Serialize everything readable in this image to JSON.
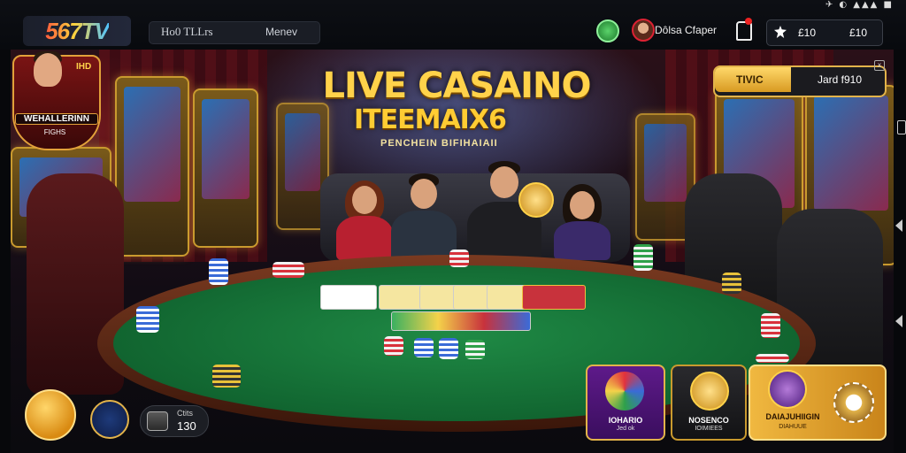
{
  "status_bar": {
    "text": "✈ ◐ ▲▲▲ ■"
  },
  "header": {
    "logo_text": "567TV",
    "nav_label_1": "Ho0 TLLrs",
    "nav_label_2": "Menev",
    "username": "Dôlsa Cfaper",
    "wallet_value_1": "£10",
    "wallet_value_2": "£10"
  },
  "hero": {
    "title_line1": "LIVE CASAINO",
    "title_line2": "ITEEMAIX6",
    "subtitle": "PENCHEIN BIFIHAIAII"
  },
  "dealer_badge": {
    "top_text": "IHD",
    "name_text": "WEHALLERINN",
    "sub_text": "FIGHS"
  },
  "promo_banner": {
    "left_label": "TIVIC",
    "right_label": "Jard f910",
    "close_symbol": "x"
  },
  "bottom_bar": {
    "chip_label": "Ctits",
    "chip_value": "130"
  },
  "tiles": [
    {
      "label": "IOHARIO",
      "sub": "Jed ok"
    },
    {
      "label": "NOSENCO",
      "sub": "IOIMIEES"
    },
    {
      "label": "DAIAJUHIIGIN",
      "sub": "DIAHUUE"
    }
  ],
  "colors": {
    "accent_gold": "#e2b34a",
    "felt_green": "#1f8a45",
    "table_wood": "#7a3a20"
  }
}
